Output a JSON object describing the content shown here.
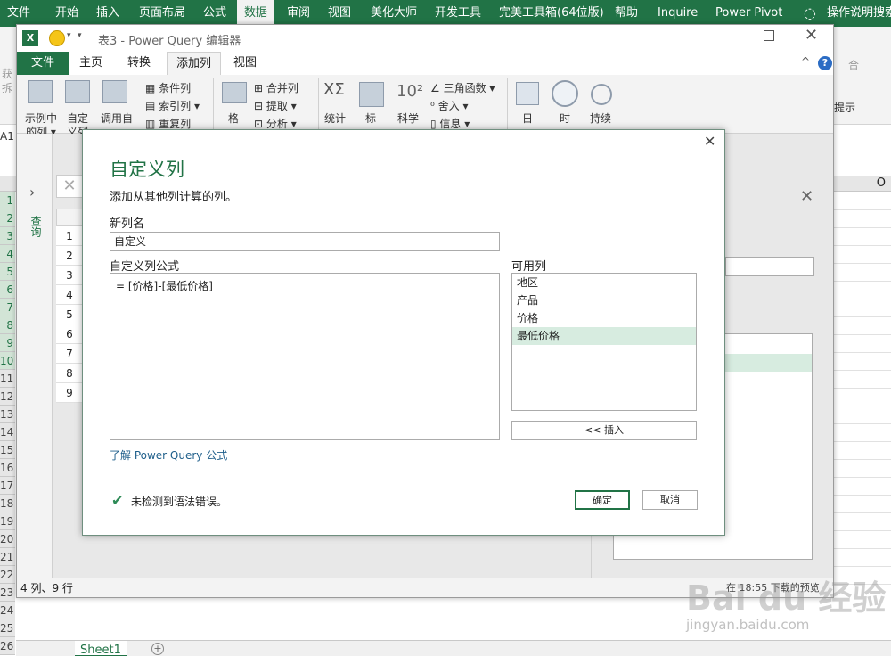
{
  "excel": {
    "tabs": [
      "文件",
      "开始",
      "插入",
      "页面布局",
      "公式",
      "数据",
      "审阅",
      "视图",
      "美化大师",
      "开发工具",
      "完美工具箱(64位版)",
      "帮助",
      "Inquire",
      "Power Pivot",
      "操作说明搜索"
    ],
    "active_tab": "数据",
    "row_numbers": [
      "1",
      "2",
      "3",
      "4",
      "5",
      "6",
      "7",
      "8",
      "9",
      "10",
      "11",
      "12",
      "13",
      "14",
      "15",
      "16",
      "17",
      "18",
      "19",
      "20",
      "21",
      "22",
      "23",
      "24",
      "25",
      "26"
    ],
    "cell_ref": "A1",
    "col_header": "O",
    "sheet_tab": "Sheet1",
    "ribbon_fragments": [
      "获",
      "拆",
      "合",
      "提示"
    ]
  },
  "pq": {
    "title": "表3 - Power Query 编辑器",
    "tabs": [
      "文件",
      "主页",
      "转换",
      "添加列",
      "视图"
    ],
    "active_tab": "添加列",
    "ribbon": {
      "col_from_examples": "示例中\n的列 ▾",
      "custom_col": "自定\n义列",
      "invoke": "调用自",
      "conditional": "条件列",
      "index": "索引列 ▾",
      "duplicate": "重复列",
      "format": "格",
      "merge": "合并列",
      "extract": "提取 ▾",
      "parse": "分析 ▾",
      "statistics": "统计",
      "standard": "标",
      "scientific": "科学",
      "trig": "三角函数 ▾",
      "rounding": "舍入 ▾",
      "info": "信息 ▾",
      "date": "日",
      "time": "时",
      "duration": "持续"
    },
    "side_label": "查询",
    "table_rows": [
      "1",
      "2",
      "3",
      "4",
      "5",
      "6",
      "7",
      "8",
      "9"
    ],
    "status_left": "4 列、9 行",
    "status_right": "在 18:55 下载的预览"
  },
  "dialog": {
    "title": "自定义列",
    "subtitle": "添加从其他列计算的列。",
    "new_col_label": "新列名",
    "new_col_value": "自定义",
    "formula_label": "自定义列公式",
    "formula_value": "= [价格]-[最低价格]",
    "available_label": "可用列",
    "available_cols": [
      "地区",
      "产品",
      "价格",
      "最低价格"
    ],
    "selected_col": "最低价格",
    "insert_button": "<< 插入",
    "learn_link": "了解 Power Query 公式",
    "status": "未检测到语法错误。",
    "ok": "确定",
    "cancel": "取消"
  },
  "watermark": {
    "brand": "Bai du 经验",
    "url": "jingyan.baidu.com"
  },
  "colors": {
    "excel_green": "#217346",
    "dialog_title": "#217346",
    "selection": "#d7ece0"
  }
}
